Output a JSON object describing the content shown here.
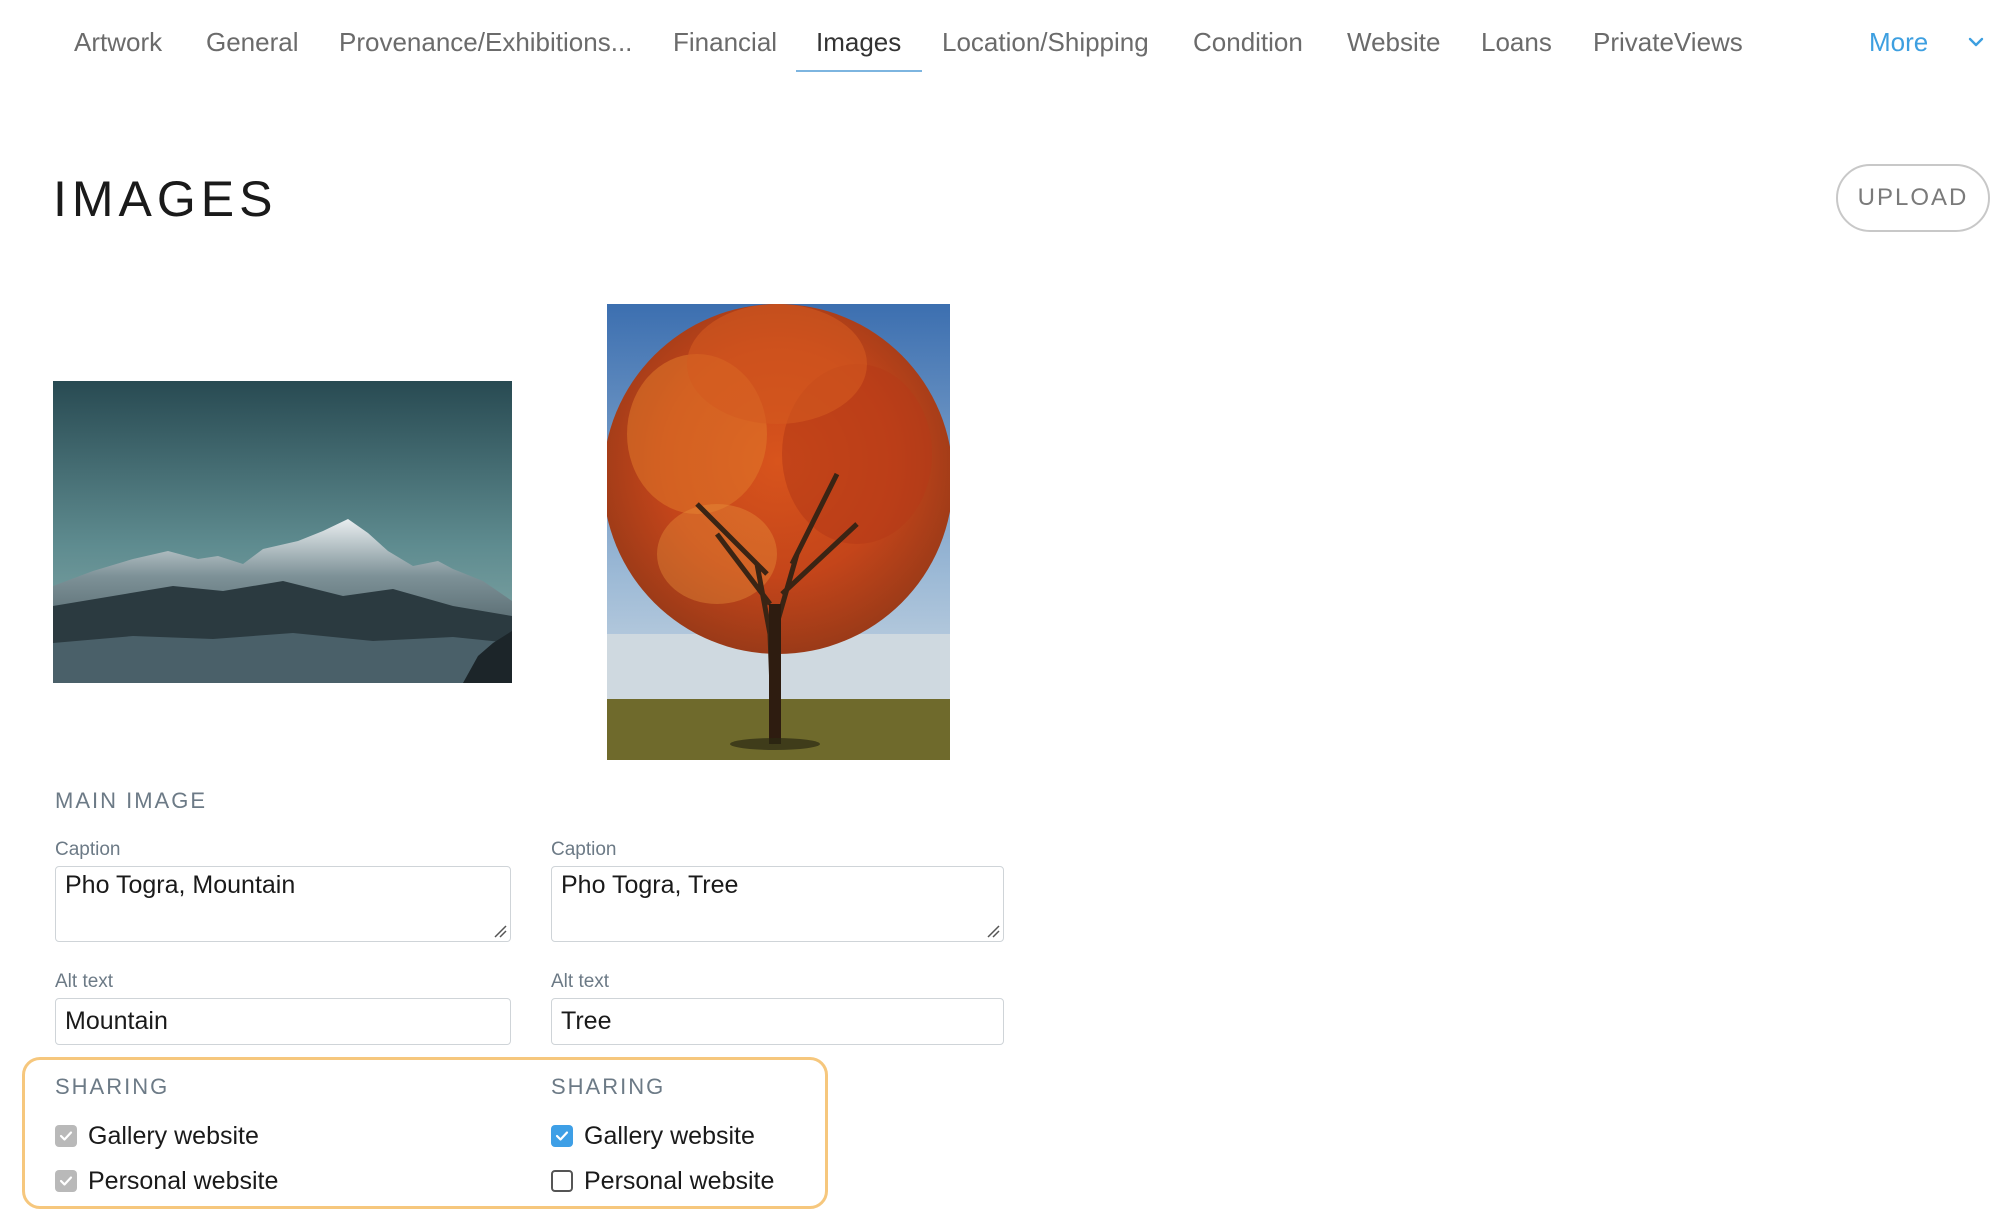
{
  "tabs": [
    {
      "label": "Artwork"
    },
    {
      "label": "General"
    },
    {
      "label": "Provenance/Exhibitions..."
    },
    {
      "label": "Financial"
    },
    {
      "label": "Images",
      "active": true
    },
    {
      "label": "Location/Shipping"
    },
    {
      "label": "Condition"
    },
    {
      "label": "Website"
    },
    {
      "label": "Loans"
    },
    {
      "label": "PrivateViews"
    }
  ],
  "more_label": "More",
  "page": {
    "title": "IMAGES",
    "upload_label": "UPLOAD"
  },
  "main_image_label": "MAIN IMAGE",
  "images": [
    {
      "caption_label": "Caption",
      "caption_value": "Pho Togra, Mountain",
      "alt_label": "Alt text",
      "alt_value": "Mountain",
      "sharing_label": "SHARING",
      "sharing": [
        {
          "label": "Gallery website",
          "state": "checked-disabled"
        },
        {
          "label": "Personal website",
          "state": "checked-disabled"
        }
      ]
    },
    {
      "caption_label": "Caption",
      "caption_value": "Pho Togra, Tree",
      "alt_label": "Alt text",
      "alt_value": "Tree",
      "sharing_label": "SHARING",
      "sharing": [
        {
          "label": "Gallery website",
          "state": "checked"
        },
        {
          "label": "Personal website",
          "state": "unchecked"
        }
      ]
    }
  ],
  "colors": {
    "accent": "#3d9fe0",
    "highlight_border": "#f6c77d",
    "tab_underline": "#7db5e0"
  }
}
